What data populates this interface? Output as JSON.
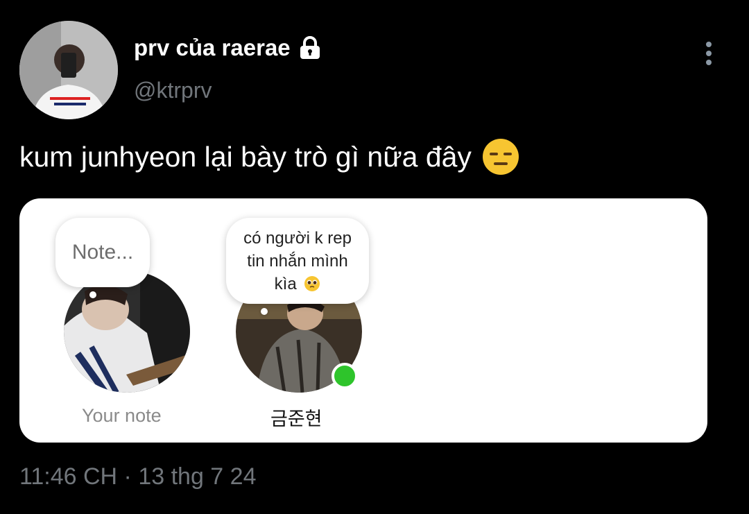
{
  "author": {
    "display_name": "prv của raerae",
    "handle": "@ktrprv",
    "avatar_icon": "avatar-photo",
    "lock_icon": "lock-icon"
  },
  "tweet": {
    "text": "kum junhyeon lại bày trò gì nữa đây",
    "emoji": "expressionless-face-emoji"
  },
  "notes_card": {
    "my_note": {
      "bubble_text": "Note...",
      "label": "Your note"
    },
    "friend_note": {
      "bubble_text": "có người k rep tin nhắn mình kìa",
      "emoji": "pleading-face-emoji",
      "label": "금준현",
      "online": true
    }
  },
  "timestamp": "11:46 CH · 13 thg 7 24",
  "colors": {
    "background": "#000000",
    "handle_gray": "#71767b",
    "online_green": "#2ec42b"
  }
}
